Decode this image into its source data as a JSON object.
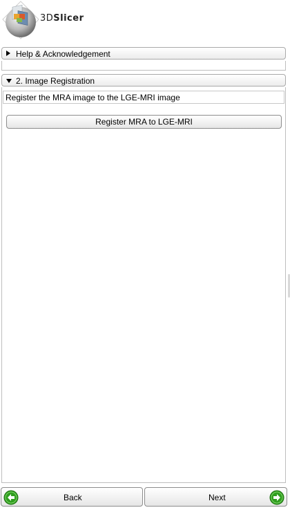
{
  "logo": {
    "text_prefix": "3D",
    "text_suffix": "Slicer"
  },
  "sections": {
    "help": {
      "label": "Help & Acknowledgement",
      "collapsed": true
    },
    "registration": {
      "label": "2. Image Registration",
      "collapsed": false
    }
  },
  "registration": {
    "description": "Register the MRA image to the LGE-MRI image",
    "register_button": "Register MRA to LGE-MRI"
  },
  "navigation": {
    "back_label": "Back",
    "next_label": "Next"
  },
  "colors": {
    "nav_icon_green": "#2f9e1e",
    "border": "#a9a9a9"
  },
  "icons": {
    "back": "arrow-left-circle-icon",
    "next": "arrow-right-circle-icon"
  }
}
